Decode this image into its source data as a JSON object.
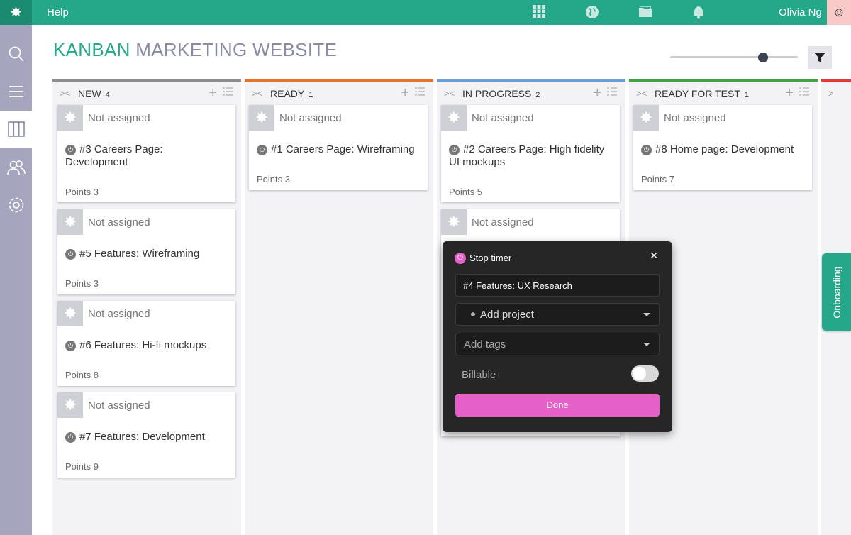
{
  "topbar": {
    "help_label": "Help",
    "user_name": "Olivia Ng",
    "icons": [
      "apps-grid-icon",
      "globe-icon",
      "folder-icon",
      "bell-icon"
    ],
    "accent_color": "#25a78a"
  },
  "sidebar": {
    "items": [
      {
        "icon": "search-icon"
      },
      {
        "icon": "list-icon"
      },
      {
        "icon": "kanban-board-icon",
        "active": true
      },
      {
        "icon": "users-icon"
      },
      {
        "icon": "settings-icon"
      }
    ]
  },
  "page": {
    "title_primary": "KANBAN",
    "title_secondary": "MARKETING WEBSITE"
  },
  "board": {
    "columns": [
      {
        "name": "NEW",
        "count": "4",
        "color": "#8c8c8c",
        "cards": [
          {
            "assignee": "Not assigned",
            "title_line1": "#3 Careers Page:",
            "title_line2": "Development",
            "points": "Points 3"
          },
          {
            "assignee": "Not assigned",
            "title_line1": "#5 Features: Wireframing",
            "title_line2": "",
            "points": "Points 3"
          },
          {
            "assignee": "Not assigned",
            "title_line1": "#6 Features: Hi-fi mockups",
            "title_line2": "",
            "points": "Points 8"
          },
          {
            "assignee": "Not assigned",
            "title_line1": "#7 Features: Development",
            "title_line2": "",
            "points": "Points 9"
          }
        ]
      },
      {
        "name": "READY",
        "count": "1",
        "color": "#e8722a",
        "cards": [
          {
            "assignee": "Not assigned",
            "title_line1": "#1 Careers Page: Wireframing",
            "title_line2": "",
            "points": "Points 3"
          }
        ]
      },
      {
        "name": "IN PROGRESS",
        "count": "2",
        "color": "#6a9ed6",
        "cards": [
          {
            "assignee": "Not assigned",
            "title_line1": "#2 Careers Page: High fidelity",
            "title_line2": "UI mockups",
            "points": "Points 5"
          },
          {
            "assignee": "Not assigned",
            "title_line1": "",
            "title_line2": "",
            "points": ""
          }
        ]
      },
      {
        "name": "READY FOR TEST",
        "count": "1",
        "color": "#3fa33f",
        "cards": [
          {
            "assignee": "Not assigned",
            "title_line1": "#8 Home page: Development",
            "title_line2": "",
            "points": "Points 7"
          }
        ]
      }
    ]
  },
  "timer_popup": {
    "stop_label": "Stop timer",
    "description": "#4 Features: UX Research",
    "project_placeholder": "Add project",
    "tags_placeholder": "Add tags",
    "billable_label": "Billable",
    "billable_on": false,
    "done_label": "Done",
    "accent_color": "#e660c9"
  },
  "onboarding": {
    "label": "Onboarding"
  }
}
